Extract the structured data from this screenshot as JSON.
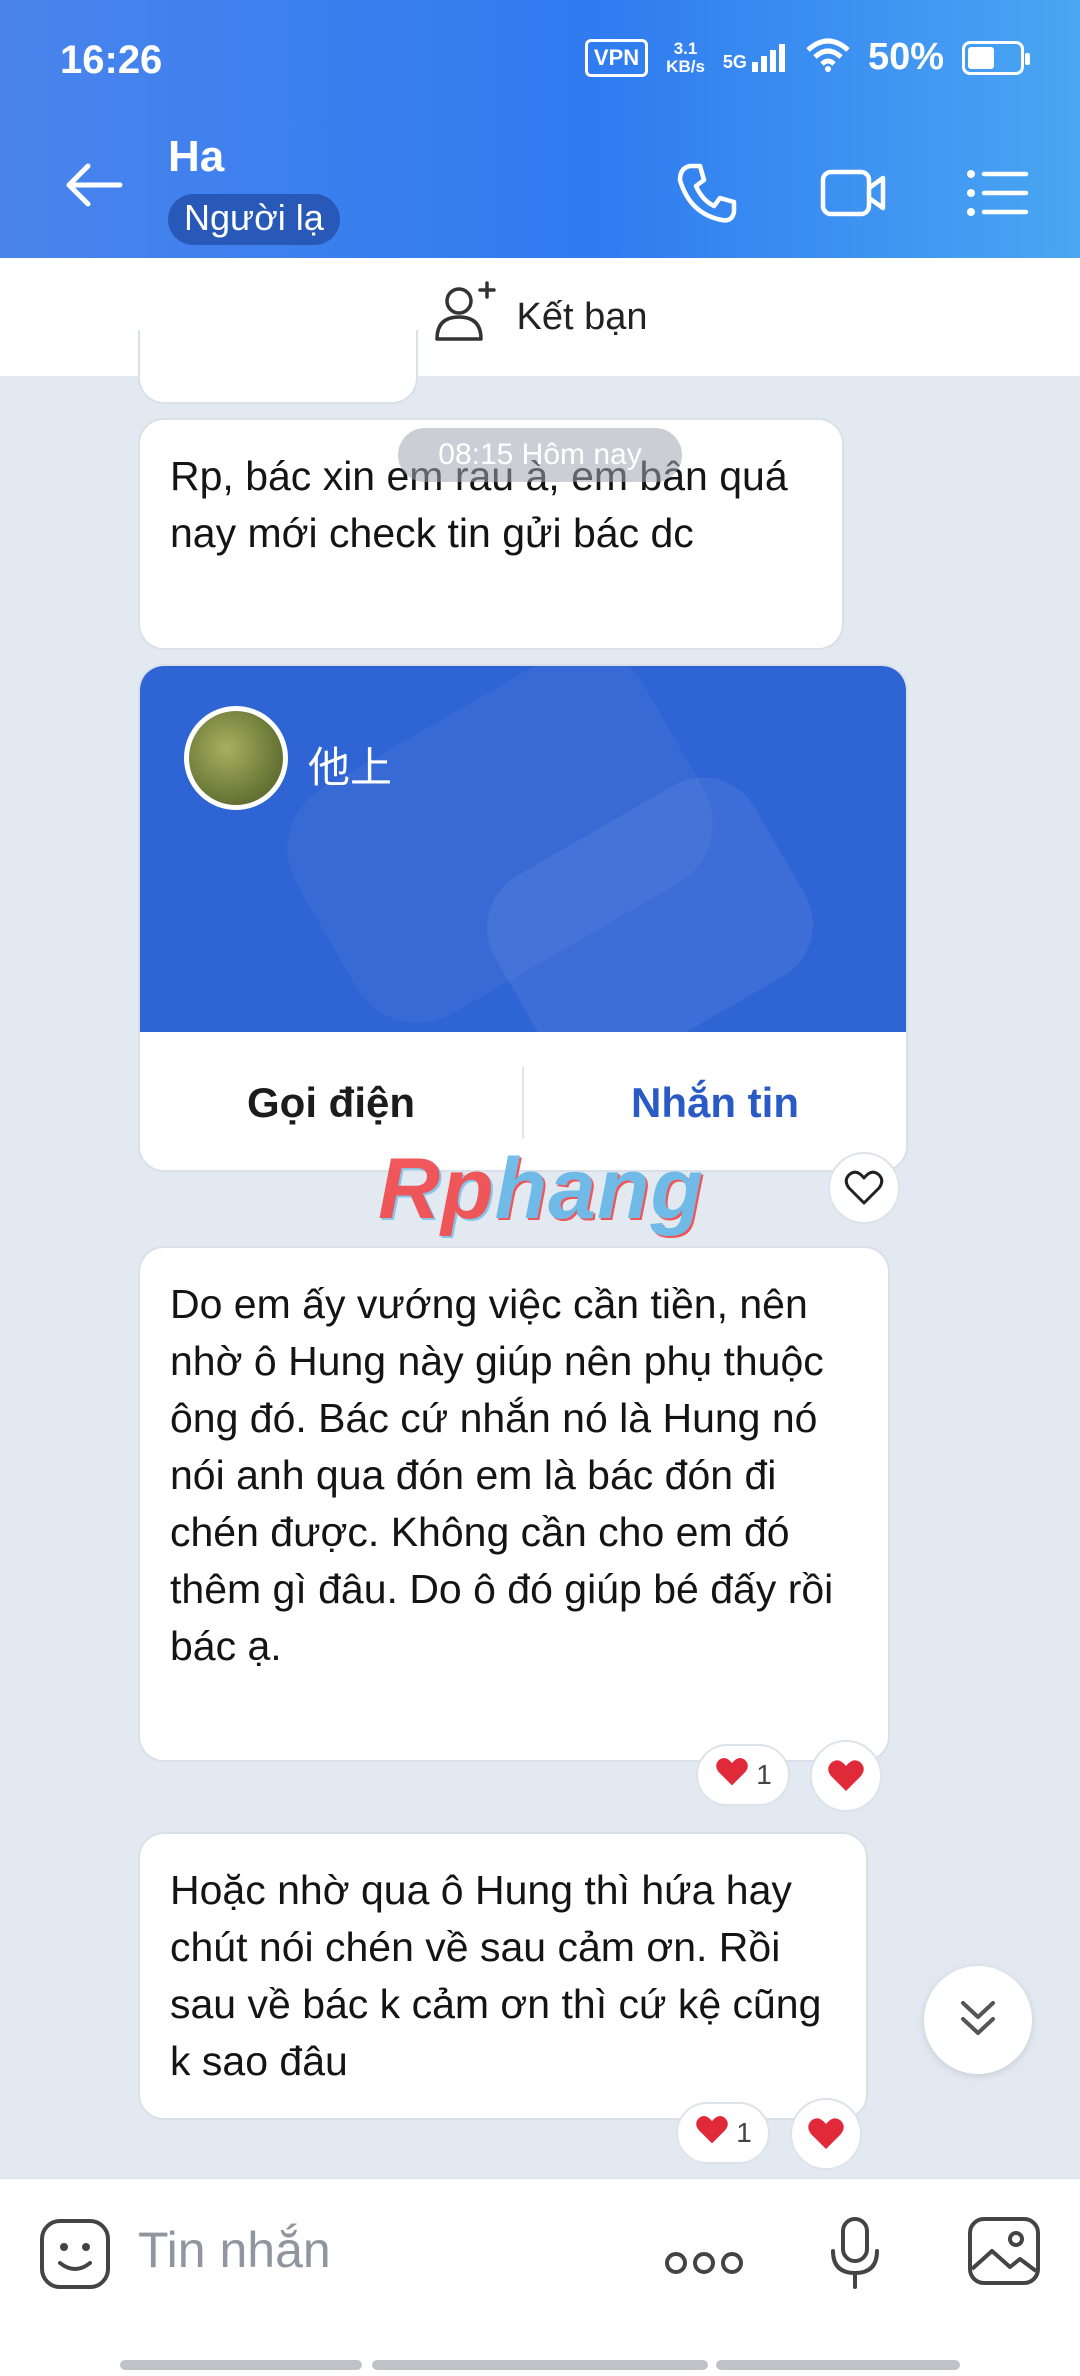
{
  "status_bar": {
    "time": "16:26",
    "vpn": "VPN",
    "speed_value": "3.1",
    "speed_unit": "KB/s",
    "network": "5G",
    "battery": "50%"
  },
  "header": {
    "contact_name": "Ha",
    "badge": "Người lạ"
  },
  "friend_bar": {
    "label": "Kết bạn"
  },
  "time_divider": "08:15 Hôm nay",
  "messages": [
    {
      "text": "Rp, bác xin em rau à, em bân quá nay mới check tin gửi bác dc"
    },
    {
      "text": "Do em ấy vướng việc cần tiền, nên nhờ ô Hung này giúp nên phụ thuộc ông đó. Bác cứ nhắn nó là Hung nó nói anh qua đón em là bác đón đi chén được. Không cần cho em đó thêm gì đâu. Do ô đó giúp bé đấy rồi bác ạ.",
      "reaction_count": "1"
    },
    {
      "text": "Hoặc nhờ qua ô Hung thì hứa hay chút nói chén về sau cảm ơn. Rồi sau về bác k cảm ơn thì cứ kệ cũng k sao đâu",
      "reaction_count": "1"
    }
  ],
  "contact_card": {
    "name": "他上",
    "call_label": "Gọi điện",
    "message_label": "Nhắn tin"
  },
  "watermark": {
    "part1": "Rp",
    "part2": "hang"
  },
  "composer": {
    "placeholder": "Tin nhắn"
  },
  "colors": {
    "header_gradient_start": "#4a84ec",
    "header_gradient_end": "#4aa6f2",
    "card_blue": "#2f64d4",
    "link_blue": "#2a5bc4",
    "heart_red": "#e02a3a",
    "chat_bg": "#e2e9f1"
  }
}
